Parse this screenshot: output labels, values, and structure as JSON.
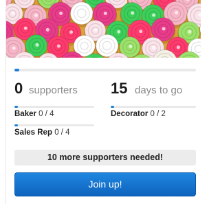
{
  "campaign": {
    "progress_fraction": 0.01,
    "supporters_count": "0",
    "supporters_label": "supporters",
    "days_count": "15",
    "days_label": "days to go"
  },
  "roles": [
    {
      "name": "Baker",
      "count": "0 / 4",
      "progress_fraction": 0.02
    },
    {
      "name": "Decorator",
      "count": "0 / 2",
      "progress_fraction": 0.02
    },
    {
      "name": "Sales Rep",
      "count": "0 / 4",
      "progress_fraction": 0.02
    }
  ],
  "notice_text": "10 more supporters needed!",
  "join_button_label": "Join up!",
  "colors": {
    "accent": "#1e7fd6",
    "button_top": "#1f86e0",
    "button_bottom": "#0e63bd",
    "notice_bg": "#ececec",
    "muted_text": "#8a8a8a"
  },
  "hero_image": "cupcakes-photo"
}
